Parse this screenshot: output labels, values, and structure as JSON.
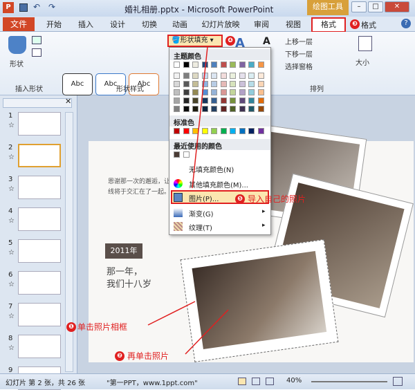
{
  "window": {
    "title": "婚礼相册.pptx - Microsoft PowerPoint",
    "context_tab_group": "绘图工具",
    "app_icon": "P"
  },
  "tabs": [
    "文件",
    "开始",
    "插入",
    "设计",
    "切换",
    "动画",
    "幻灯片放映",
    "审阅",
    "视图",
    "格式"
  ],
  "ribbon": {
    "insert_shapes_label": "插入形状",
    "shapes_label": "形状",
    "shape_styles_label": "形状样式",
    "abc": "Abc",
    "shape_fill_button": "形状填充",
    "bring_forward": "上移一层",
    "send_backward": "下移一层",
    "selection_pane": "选择窗格",
    "arrange_label": "排列",
    "size_label": "大小"
  },
  "dropdown": {
    "theme_colors": "主题颜色",
    "standard_colors": "标准色",
    "recent_colors": "最近使用的颜色",
    "no_fill": "无填充颜色(N)",
    "more_fill": "其他填充颜色(M)...",
    "picture": "图片(P)...",
    "gradient": "渐变(G)",
    "texture": "纹理(T)",
    "theme_rows": [
      [
        "#ffffff",
        "#000000",
        "#eeece1",
        "#1f497d",
        "#4f81bd",
        "#c0504d",
        "#9bbb59",
        "#8064a2",
        "#4bacc6",
        "#f79646"
      ],
      [
        "#f2f2f2",
        "#7f7f7f",
        "#ddd9c3",
        "#c6d9f0",
        "#dbe5f1",
        "#f2dcdb",
        "#ebf1dd",
        "#e5e0ec",
        "#dbeef3",
        "#fdeada"
      ],
      [
        "#d8d8d8",
        "#595959",
        "#c4bd97",
        "#8db3e2",
        "#b8cce4",
        "#e5b9b7",
        "#d7e3bc",
        "#ccc1d9",
        "#b7dde8",
        "#fbd5b5"
      ],
      [
        "#bfbfbf",
        "#3f3f3f",
        "#938953",
        "#548dd4",
        "#95b3d7",
        "#d99694",
        "#c3d69b",
        "#b2a2c7",
        "#92cddc",
        "#fac08f"
      ],
      [
        "#a5a5a5",
        "#262626",
        "#494429",
        "#17365d",
        "#366092",
        "#953734",
        "#76923c",
        "#5f497a",
        "#31859b",
        "#e36c09"
      ],
      [
        "#7f7f7f",
        "#0c0c0c",
        "#1d1b10",
        "#0f243e",
        "#244061",
        "#632423",
        "#4f6128",
        "#3f3151",
        "#205867",
        "#974806"
      ]
    ],
    "standard": [
      "#c00000",
      "#ff0000",
      "#ffc000",
      "#ffff00",
      "#92d050",
      "#00b050",
      "#00b0f0",
      "#0070c0",
      "#002060",
      "#7030a0"
    ],
    "recent": [
      "#4a3b35",
      "#ffffff"
    ]
  },
  "slides": {
    "numbers": [
      "1",
      "2",
      "3",
      "4",
      "5",
      "6",
      "7",
      "8",
      "9"
    ],
    "star": "☆"
  },
  "slide": {
    "body_text": "恩谢那一次的邂逅，让\n线将于交汇在了一起。",
    "year": "2011年",
    "line1": "那一年，",
    "line2": "我们十八岁"
  },
  "callouts": [
    {
      "num": "❸",
      "text": "格式"
    },
    {
      "num": "❹",
      "text": ""
    },
    {
      "num": "❺",
      "text": "导入自己的照片"
    },
    {
      "num": "❶",
      "text": "单击照片相框"
    },
    {
      "num": "❷",
      "text": "再单击照片"
    }
  ],
  "status": {
    "slide_info": "幻灯片 第 2 张，共 26 张",
    "theme": "\"第一PPT，www.1ppt.com\"",
    "zoom": "40%"
  },
  "colors": {
    "accent": "#d24726",
    "callout": "#e02020",
    "context": "#d8a03a"
  }
}
